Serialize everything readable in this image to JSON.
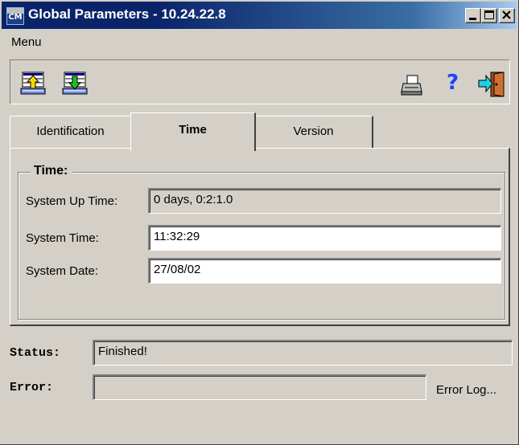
{
  "window": {
    "title": "Global Parameters - 10.24.22.8",
    "icon_text": "CM",
    "controls": [
      "minimize-icon",
      "maximize-icon",
      "close-icon"
    ]
  },
  "menu": {
    "items": [
      "Menu"
    ]
  },
  "toolbar": {
    "left": [
      "upload-icon",
      "download-icon"
    ],
    "right": [
      "print-icon",
      "help-icon",
      "exit-icon"
    ],
    "help_glyph": "?"
  },
  "tabs": [
    {
      "label": "Identification",
      "selected": false
    },
    {
      "label": "Time",
      "selected": true
    },
    {
      "label": "Version",
      "selected": false
    }
  ],
  "time_group": {
    "title": "Time:",
    "fields": [
      {
        "label": "System Up Time:",
        "value": "0 days, 0:2:1.0",
        "readonly": true
      },
      {
        "label": "System Time:",
        "value": "11:32:29",
        "readonly": false
      },
      {
        "label": "System Date:",
        "value": "27/08/02",
        "readonly": false
      }
    ]
  },
  "status": {
    "label": "Status:",
    "value": "Finished!"
  },
  "error": {
    "label": "Error:",
    "value": "",
    "log_button": "Error Log..."
  },
  "colors": {
    "titlebar_start": "#0a246a",
    "titlebar_end": "#a6caf0",
    "face": "#d4d0c8"
  }
}
